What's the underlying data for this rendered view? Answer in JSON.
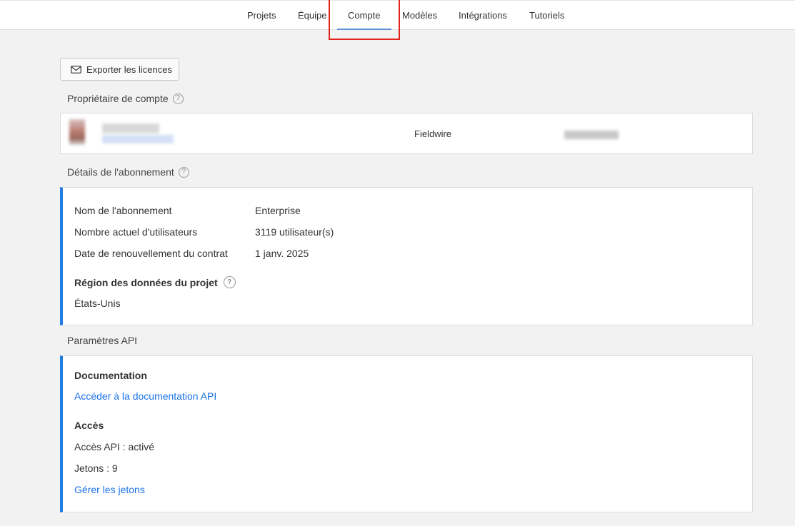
{
  "nav": {
    "tabs": [
      {
        "label": "Projets"
      },
      {
        "label": "Équipe"
      },
      {
        "label": "Compte"
      },
      {
        "label": "Modèles"
      },
      {
        "label": "Intégrations"
      },
      {
        "label": "Tutoriels"
      }
    ],
    "active_tab": "Compte"
  },
  "toolbar": {
    "export_label": "Exporter les licences",
    "export_icon": "mail-icon"
  },
  "owner": {
    "section_title": "Propriétaire de compte",
    "company": "Fieldwire"
  },
  "subscription": {
    "section_title": "Détails de l'abonnement",
    "rows": [
      {
        "label": "Nom de l'abonnement",
        "value": "Enterprise"
      },
      {
        "label": "Nombre actuel d'utilisateurs",
        "value": "3119 utilisateur(s)"
      },
      {
        "label": "Date de renouvellement du contrat",
        "value": "1 janv. 2025"
      }
    ],
    "region_title": "Région des données du projet",
    "region_value": "États-Unis"
  },
  "api": {
    "section_title": "Paramètres API",
    "doc_title": "Documentation",
    "doc_link": "Accéder à la documentation API",
    "access_title": "Accès",
    "access_status": "Accès API : activé",
    "tokens": "Jetons : 9",
    "manage_link": "Gérer les jetons"
  },
  "colors": {
    "accent": "#1f7ee0",
    "link": "#1a73e8",
    "highlight": "#e2231a",
    "tab_underline": "#5b8fd6"
  }
}
